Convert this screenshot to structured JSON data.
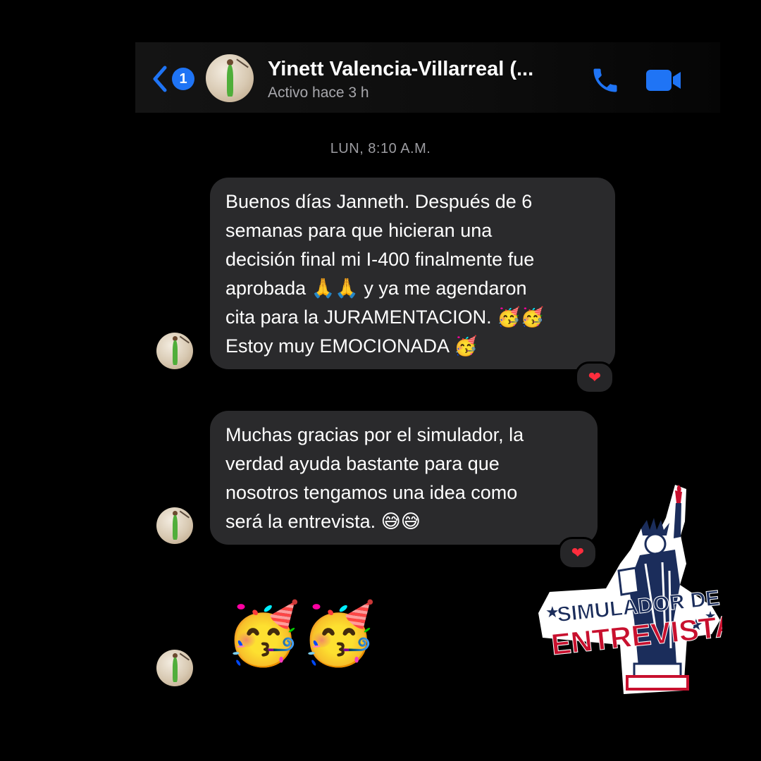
{
  "header": {
    "unread_count": "1",
    "contact_name": "Yinett Valencia-Villarreal (...",
    "status": "Activo hace 3 h"
  },
  "conversation": {
    "timestamp": "LUN, 8:10 A.M.",
    "messages": [
      {
        "lines": [
          "Buenos días Janneth. Después de 6",
          "semanas para que hicieran una",
          "decisión final mi I-400 finalmente fue",
          "aprobada 🙏🙏 y ya me agendaron",
          "cita para la JURAMENTACION. 🥳🥳",
          "Estoy muy EMOCIONADA 🥳"
        ],
        "reaction": "❤"
      },
      {
        "lines": [
          "Muchas gracias por el simulador, la",
          "verdad ayuda bastante para que",
          "nosotros tengamos una idea como",
          "será la entrevista. 😅😅"
        ],
        "reaction": "❤"
      },
      {
        "emoji": "🥳🥳"
      }
    ]
  },
  "sticker": {
    "line1": "SIMULADOR DE",
    "line2": "ENTREVISTA"
  },
  "colors": {
    "accent": "#1f74f5",
    "bubble": "#2a2a2c",
    "background": "#000000",
    "heart": "#ff2d3d",
    "sticker_red": "#c8102e",
    "sticker_navy": "#1b2d5b"
  }
}
